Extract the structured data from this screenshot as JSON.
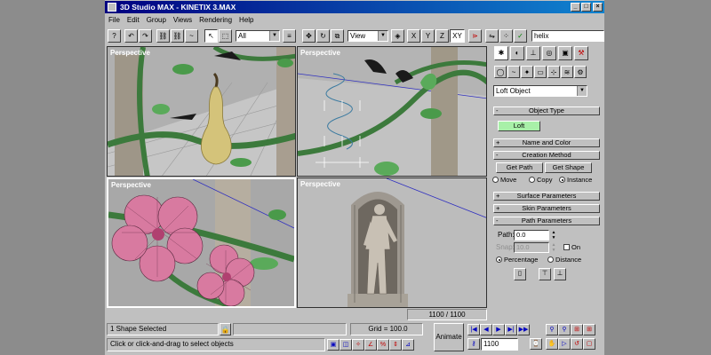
{
  "window": {
    "title": "3D Studio MAX - KINETIX 3.MAX",
    "min": "_",
    "max": "□",
    "close": "×"
  },
  "menu": [
    "File",
    "Edit",
    "Group",
    "Views",
    "Rendering",
    "Help"
  ],
  "toolbar": {
    "selection_filter": "All",
    "coord_system": "View",
    "axes": [
      "X",
      "Y",
      "Z",
      "XY"
    ],
    "named_selection": "helix"
  },
  "viewports": [
    {
      "label": "Perspective"
    },
    {
      "label": "Perspective"
    },
    {
      "label": "Perspective"
    },
    {
      "label": "Perspective"
    }
  ],
  "frame_counter": "1100 / 1100",
  "command_panel": {
    "object_category": "Loft Object",
    "rollouts": {
      "object_type": "Object Type",
      "name_and_color": "Name and Color",
      "creation_method": "Creation Method",
      "surface_parameters": "Surface Parameters",
      "skin_parameters": "Skin Parameters",
      "path_parameters": "Path Parameters"
    },
    "loft_button": "Loft",
    "get_path": "Get Path",
    "get_shape": "Get Shape",
    "move": "Move",
    "copy": "Copy",
    "instance": "Instance",
    "path_label": "Path:",
    "path_value": "0.0",
    "snap_label": "Snap:",
    "snap_value": "10.0",
    "on_label": "On",
    "percentage": "Percentage",
    "distance": "Distance",
    "rollout_minus": "-",
    "rollout_plus": "+"
  },
  "status": {
    "selection": "1 Shape Selected",
    "prompt": "Click or click-and-drag to select objects",
    "grid": "Grid = 100.0",
    "animate": "Animate",
    "current_frame": "1100"
  },
  "colors": {
    "title_start": "#000080",
    "title_end": "#1084d0",
    "face": "#c0c0c0",
    "loft_button": "#a8f0a8"
  }
}
